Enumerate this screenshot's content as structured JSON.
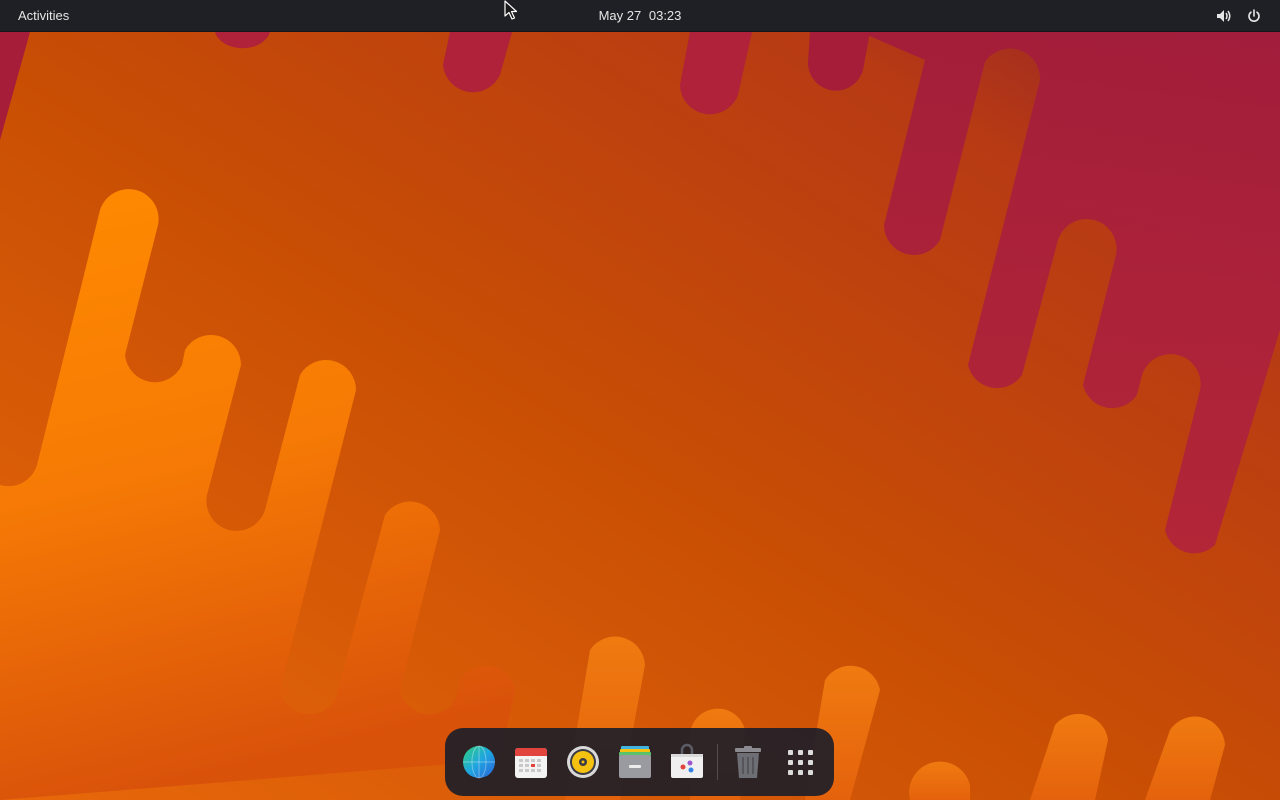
{
  "topbar": {
    "activities_label": "Activities",
    "clock_date": "May 27",
    "clock_time": "03:23",
    "volume_icon": "speaker-volume-icon",
    "power_icon": "power-icon"
  },
  "dock": {
    "items": [
      {
        "id": "browser",
        "icon": "globe-browser-icon"
      },
      {
        "id": "calendar",
        "icon": "calendar-icon"
      },
      {
        "id": "music",
        "icon": "music-player-icon"
      },
      {
        "id": "files",
        "icon": "file-manager-icon"
      },
      {
        "id": "software",
        "icon": "software-store-icon"
      },
      {
        "id": "trash",
        "icon": "trash-icon"
      },
      {
        "id": "apps",
        "icon": "show-applications-icon"
      }
    ]
  },
  "colors": {
    "wallpaper_base": "#c75208",
    "wallpaper_light": "#ff8a00",
    "wallpaper_dark": "#a31f3a",
    "topbar_bg": "#1f1f26",
    "dock_bg": "#1e1e28"
  }
}
